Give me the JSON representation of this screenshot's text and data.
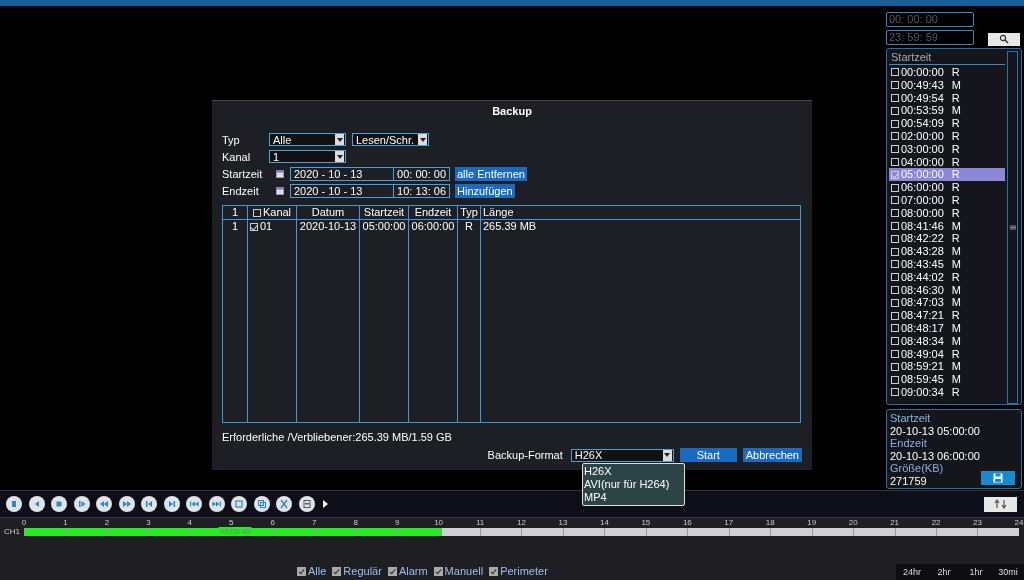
{
  "backup_dialog": {
    "title": "Backup",
    "typ": {
      "label": "Typ",
      "value": "Alle",
      "mode": "Lesen/Schr."
    },
    "kanal": {
      "label": "Kanal",
      "value": "1"
    },
    "startzeit": {
      "label": "Startzeit",
      "date": "2020 - 10 - 13",
      "time": "00: 00: 00",
      "button": "alle Entfernen"
    },
    "endzeit": {
      "label": "Endzeit",
      "date": "2020 - 10 - 13",
      "time": "10: 13: 06",
      "button": "Hinzufügen"
    },
    "table": {
      "columns": [
        "1",
        "Kanal",
        "Datum",
        "Startzeit",
        "Endzeit",
        "Typ",
        "Länge"
      ],
      "header_checked": false,
      "rows": [
        {
          "index": "1",
          "checked": true,
          "kanal": "01",
          "datum": "2020-10-13",
          "startzeit": "05:00:00",
          "endzeit": "06:00:00",
          "typ": "R",
          "laenge": "265.39 MB"
        }
      ]
    },
    "space_info": "Erforderliche /Verbliebener:265.39 MB/1.59 GB",
    "format": {
      "label": "Backup-Format",
      "value": "H26X",
      "options": [
        "H26X",
        "AVI(nur für H264)",
        "MP4"
      ]
    },
    "buttons": [
      "Start",
      "Abbrechen"
    ]
  },
  "time_filter": {
    "from": "00: 00: 00",
    "to": "23: 59: 59"
  },
  "file_list": {
    "header": "Startzeit",
    "items": [
      {
        "time": "00:00:00",
        "type": "R",
        "checked": false,
        "selected": false
      },
      {
        "time": "00:49:43",
        "type": "M",
        "checked": false,
        "selected": false
      },
      {
        "time": "00:49:54",
        "type": "R",
        "checked": false,
        "selected": false
      },
      {
        "time": "00:53:59",
        "type": "M",
        "checked": false,
        "selected": false
      },
      {
        "time": "00:54:09",
        "type": "R",
        "checked": false,
        "selected": false
      },
      {
        "time": "02:00:00",
        "type": "R",
        "checked": false,
        "selected": false
      },
      {
        "time": "03:00:00",
        "type": "R",
        "checked": false,
        "selected": false
      },
      {
        "time": "04:00:00",
        "type": "R",
        "checked": false,
        "selected": false
      },
      {
        "time": "05:00:00",
        "type": "R",
        "checked": true,
        "selected": true
      },
      {
        "time": "06:00:00",
        "type": "R",
        "checked": false,
        "selected": false
      },
      {
        "time": "07:00:00",
        "type": "R",
        "checked": false,
        "selected": false
      },
      {
        "time": "08:00:00",
        "type": "R",
        "checked": false,
        "selected": false
      },
      {
        "time": "08:41:46",
        "type": "M",
        "checked": false,
        "selected": false
      },
      {
        "time": "08:42:22",
        "type": "R",
        "checked": false,
        "selected": false
      },
      {
        "time": "08:43:28",
        "type": "M",
        "checked": false,
        "selected": false
      },
      {
        "time": "08:43:45",
        "type": "M",
        "checked": false,
        "selected": false
      },
      {
        "time": "08:44:02",
        "type": "R",
        "checked": false,
        "selected": false
      },
      {
        "time": "08:46:30",
        "type": "M",
        "checked": false,
        "selected": false
      },
      {
        "time": "08:47:03",
        "type": "M",
        "checked": false,
        "selected": false
      },
      {
        "time": "08:47:21",
        "type": "R",
        "checked": false,
        "selected": false
      },
      {
        "time": "08:48:17",
        "type": "M",
        "checked": false,
        "selected": false
      },
      {
        "time": "08:48:34",
        "type": "M",
        "checked": false,
        "selected": false
      },
      {
        "time": "08:49:04",
        "type": "R",
        "checked": false,
        "selected": false
      },
      {
        "time": "08:59:21",
        "type": "M",
        "checked": false,
        "selected": false
      },
      {
        "time": "08:59:45",
        "type": "M",
        "checked": false,
        "selected": false
      },
      {
        "time": "09:00:34",
        "type": "R",
        "checked": false,
        "selected": false
      }
    ]
  },
  "file_info": {
    "start_label": "Startzeit",
    "start": "20-10-13 05:00:00",
    "end_label": "Endzeit",
    "end": "20-10-13 06:00:00",
    "size_label": "Größe(KB)",
    "size": "271759"
  },
  "timeline": {
    "channel": "CH1",
    "hours": [
      "0",
      "1",
      "2",
      "3",
      "4",
      "5",
      "6",
      "7",
      "8",
      "9",
      "10",
      "11",
      "12",
      "13",
      "14",
      "15",
      "16",
      "17",
      "18",
      "19",
      "20",
      "21",
      "22",
      "23",
      "24"
    ],
    "level": 0.42,
    "cursor": "05:05:45"
  },
  "filters": [
    {
      "label": "Alle",
      "checked": true
    },
    {
      "label": "Regulär",
      "checked": true
    },
    {
      "label": "Alarm",
      "checked": true
    },
    {
      "label": "Manuell",
      "checked": true
    },
    {
      "label": "Perimeter",
      "checked": true
    }
  ],
  "zoom": [
    "24hr",
    "2hr",
    "1hr",
    "30mi"
  ]
}
